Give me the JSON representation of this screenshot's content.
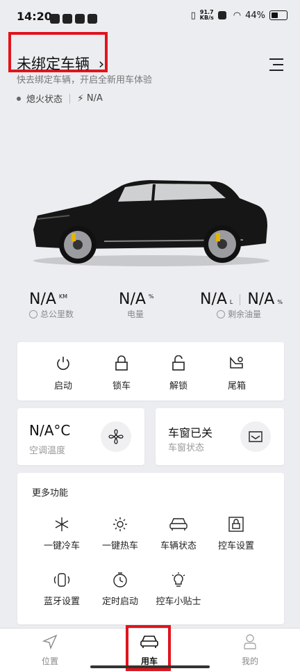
{
  "status_bar": {
    "time": "14:20",
    "network_speed_top": "91.7",
    "network_speed_unit": "KB/s",
    "battery": "44%"
  },
  "header": {
    "title": "未绑定车辆",
    "title_chevron": "›",
    "subtitle": "快去绑定车辆，开启全新用车体验",
    "engine_status": "熄火状态",
    "charge_value": "N/A"
  },
  "stats": {
    "mileage": {
      "value": "N/A",
      "unit": "KM",
      "label": "总公里数"
    },
    "battery": {
      "value": "N/A",
      "unit": "%",
      "label": "电量"
    },
    "fuel_l": {
      "value": "N/A",
      "unit": "L"
    },
    "fuel_pct": {
      "value": "N/A",
      "unit": "%",
      "label": "剩余油量"
    }
  },
  "controls": [
    {
      "label": "启动",
      "icon": "power-icon"
    },
    {
      "label": "锁车",
      "icon": "lock-icon"
    },
    {
      "label": "解锁",
      "icon": "unlock-icon"
    },
    {
      "label": "尾箱",
      "icon": "trunk-icon"
    }
  ],
  "climate": {
    "value": "N/A",
    "unit": "°C",
    "label": "空调温度",
    "icon": "fan-icon"
  },
  "window": {
    "value": "车窗已关",
    "label": "车窗状态",
    "icon": "window-icon"
  },
  "more": {
    "title": "更多功能",
    "items": [
      {
        "label": "一键冷车",
        "icon": "snowflake-icon"
      },
      {
        "label": "一键热车",
        "icon": "sun-icon"
      },
      {
        "label": "车辆状态",
        "icon": "car-front-icon"
      },
      {
        "label": "控车设置",
        "icon": "lock-settings-icon"
      },
      {
        "label": "蓝牙设置",
        "icon": "bluetooth-car-icon"
      },
      {
        "label": "定时启动",
        "icon": "timer-icon"
      },
      {
        "label": "控车小贴士",
        "icon": "lightbulb-icon"
      }
    ]
  },
  "tabs": [
    {
      "label": "位置",
      "icon": "location-arrow-icon"
    },
    {
      "label": "用车",
      "icon": "car-icon"
    },
    {
      "label": "我的",
      "icon": "person-icon"
    }
  ],
  "colors": {
    "highlight": "#e0141c",
    "background": "#ecedf0"
  }
}
